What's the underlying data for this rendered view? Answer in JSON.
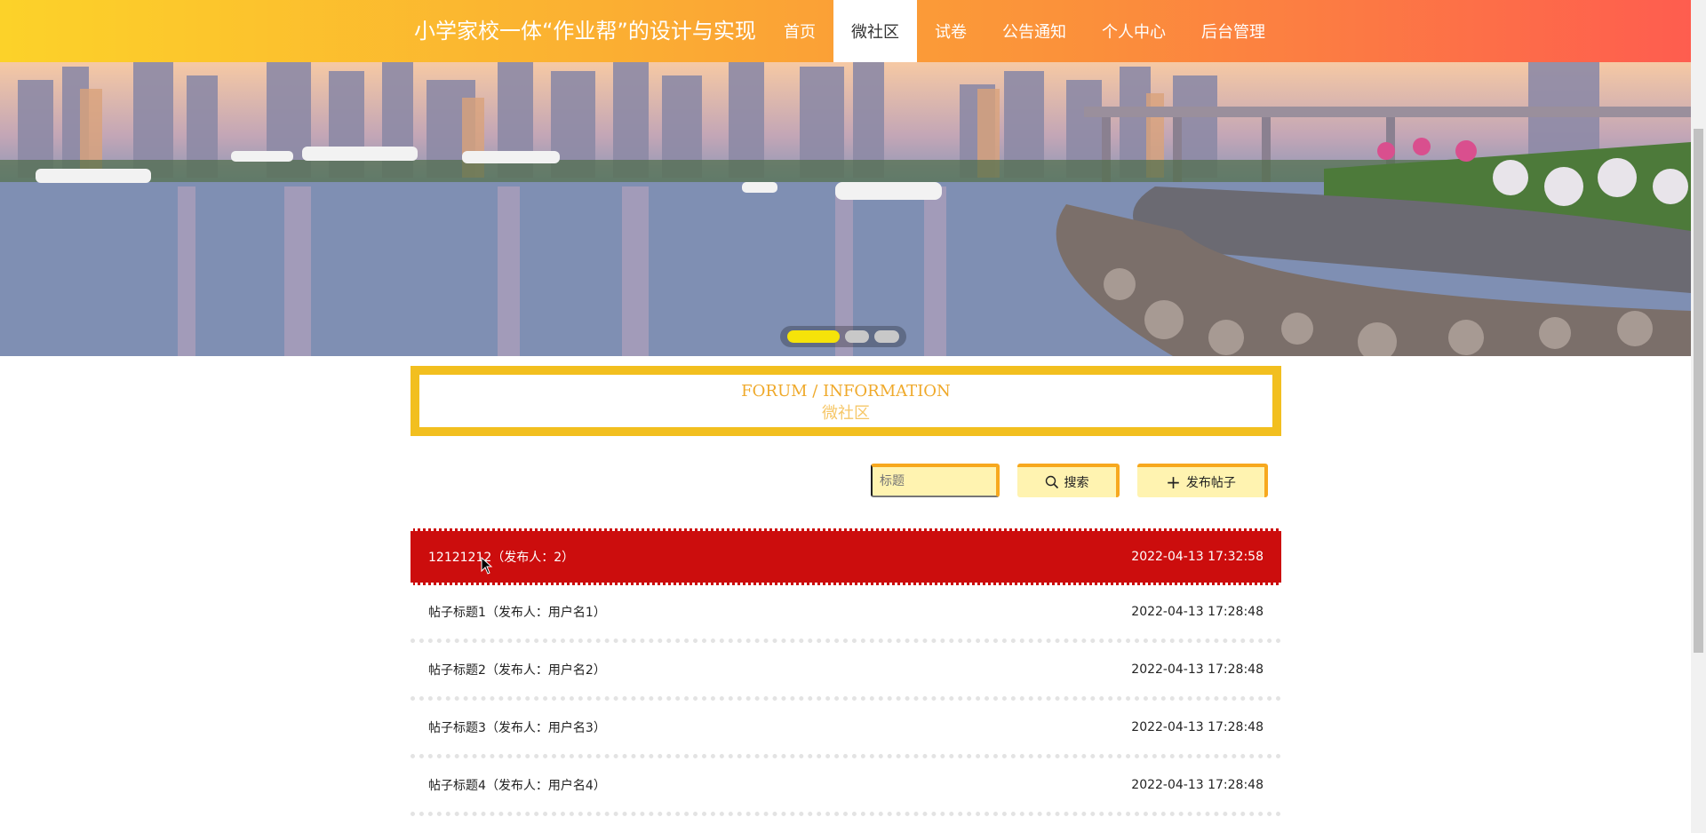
{
  "header": {
    "site_title": "小学家校一体“作业帮”的设计与实现",
    "nav": [
      {
        "label": "首页",
        "active": false
      },
      {
        "label": "微社区",
        "active": true
      },
      {
        "label": "试卷",
        "active": false
      },
      {
        "label": "公告通知",
        "active": false
      },
      {
        "label": "个人中心",
        "active": false
      },
      {
        "label": "后台管理",
        "active": false
      }
    ]
  },
  "carousel": {
    "slides": 3,
    "active_index": 0
  },
  "section": {
    "title_en": "FORUM / INFORMATION",
    "title_cn": "微社区"
  },
  "toolbar": {
    "search_placeholder": "标题",
    "search_label": "搜索",
    "add_label": "发布帖子"
  },
  "posts": [
    {
      "title": "12121212（发布人：2）",
      "time": "2022-04-13 17:32:58"
    },
    {
      "title": "帖子标题1（发布人：用户名1）",
      "time": "2022-04-13 17:28:48"
    },
    {
      "title": "帖子标题2（发布人：用户名2）",
      "time": "2022-04-13 17:28:48"
    },
    {
      "title": "帖子标题3（发布人：用户名3）",
      "time": "2022-04-13 17:28:48"
    },
    {
      "title": "帖子标题4（发布人：用户名4）",
      "time": "2022-04-13 17:28:48"
    }
  ],
  "colors": {
    "accent": "#f2bf1f",
    "highlight_row": "#cc0d0d",
    "button_bg": "#fff3b0"
  }
}
